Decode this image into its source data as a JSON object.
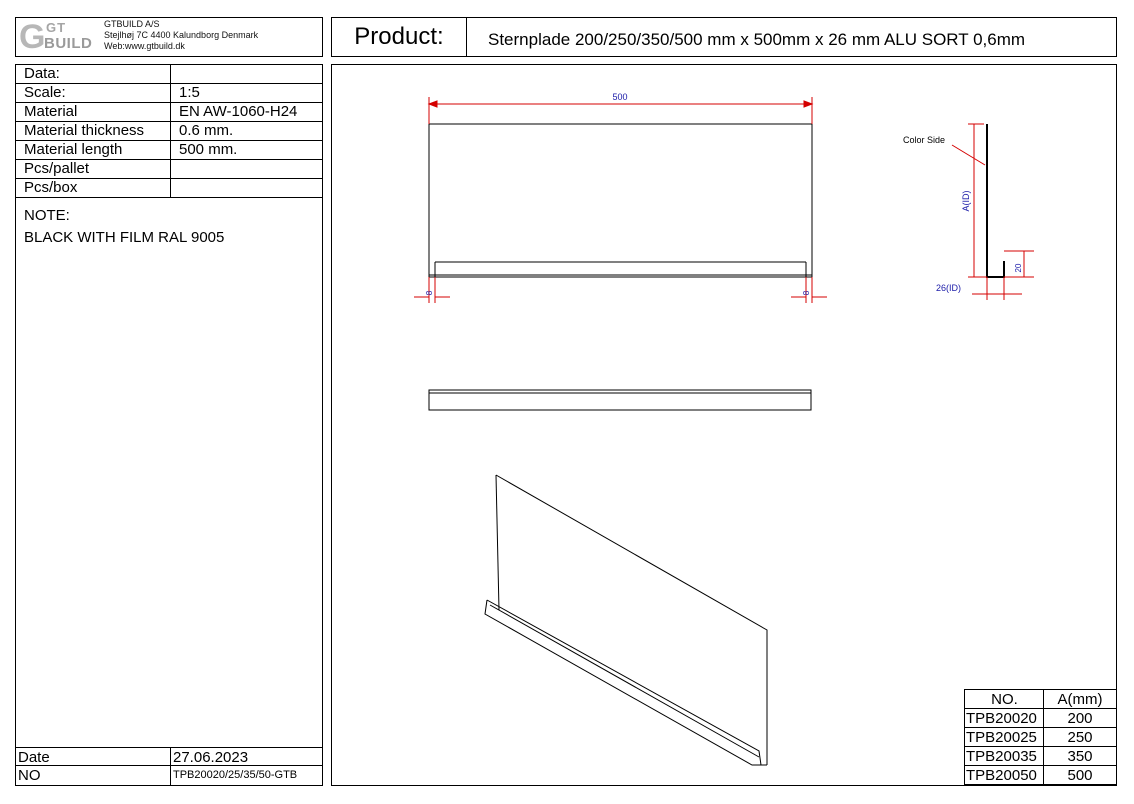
{
  "logo": {
    "g": "G",
    "gt": "GT",
    "build": "BUILD"
  },
  "company": {
    "name": "GTBUILD A/S",
    "address": "Stejlhøj 7C 4400 Kalundborg Denmark",
    "web": "Web:www.gtbuild.dk"
  },
  "product": {
    "label": "Product:",
    "title": "Sternplade 200/250/350/500 mm x 500mm x 26 mm ALU SORT 0,6mm"
  },
  "data_table": {
    "header": "Data:",
    "rows": [
      {
        "key": "Scale:",
        "value": "1:5"
      },
      {
        "key": "Material",
        "value": "EN AW-1060-H24"
      },
      {
        "key": "Material thickness",
        "value": "0.6 mm."
      },
      {
        "key": "Material length",
        "value": "500 mm."
      },
      {
        "key": "Pcs/pallet",
        "value": ""
      },
      {
        "key": "Pcs/box",
        "value": ""
      }
    ],
    "note_label": "NOTE:",
    "note_text": "BLACK WITH FILM RAL 9005",
    "date_label": "Date",
    "date_value": "27.06.2023",
    "no_label": "NO",
    "no_value": "TPB20020/25/35/50-GTB"
  },
  "drawing": {
    "width_dim": "500",
    "edge_dim_left": "8",
    "edge_dim_right": "8",
    "color_side": "Color Side",
    "height_dim": "A(ID)",
    "flange_dim": "20",
    "depth_dim": "26(ID)"
  },
  "variants": {
    "headers": [
      "NO.",
      "A(mm)"
    ],
    "rows": [
      {
        "no": "TPB20020",
        "a": "200"
      },
      {
        "no": "TPB20025",
        "a": "250"
      },
      {
        "no": "TPB20035",
        "a": "350"
      },
      {
        "no": "TPB20050",
        "a": "500"
      }
    ]
  },
  "colors": {
    "dimension": "#d40000",
    "dimension_text": "#1a1aa8",
    "line": "#000000"
  }
}
